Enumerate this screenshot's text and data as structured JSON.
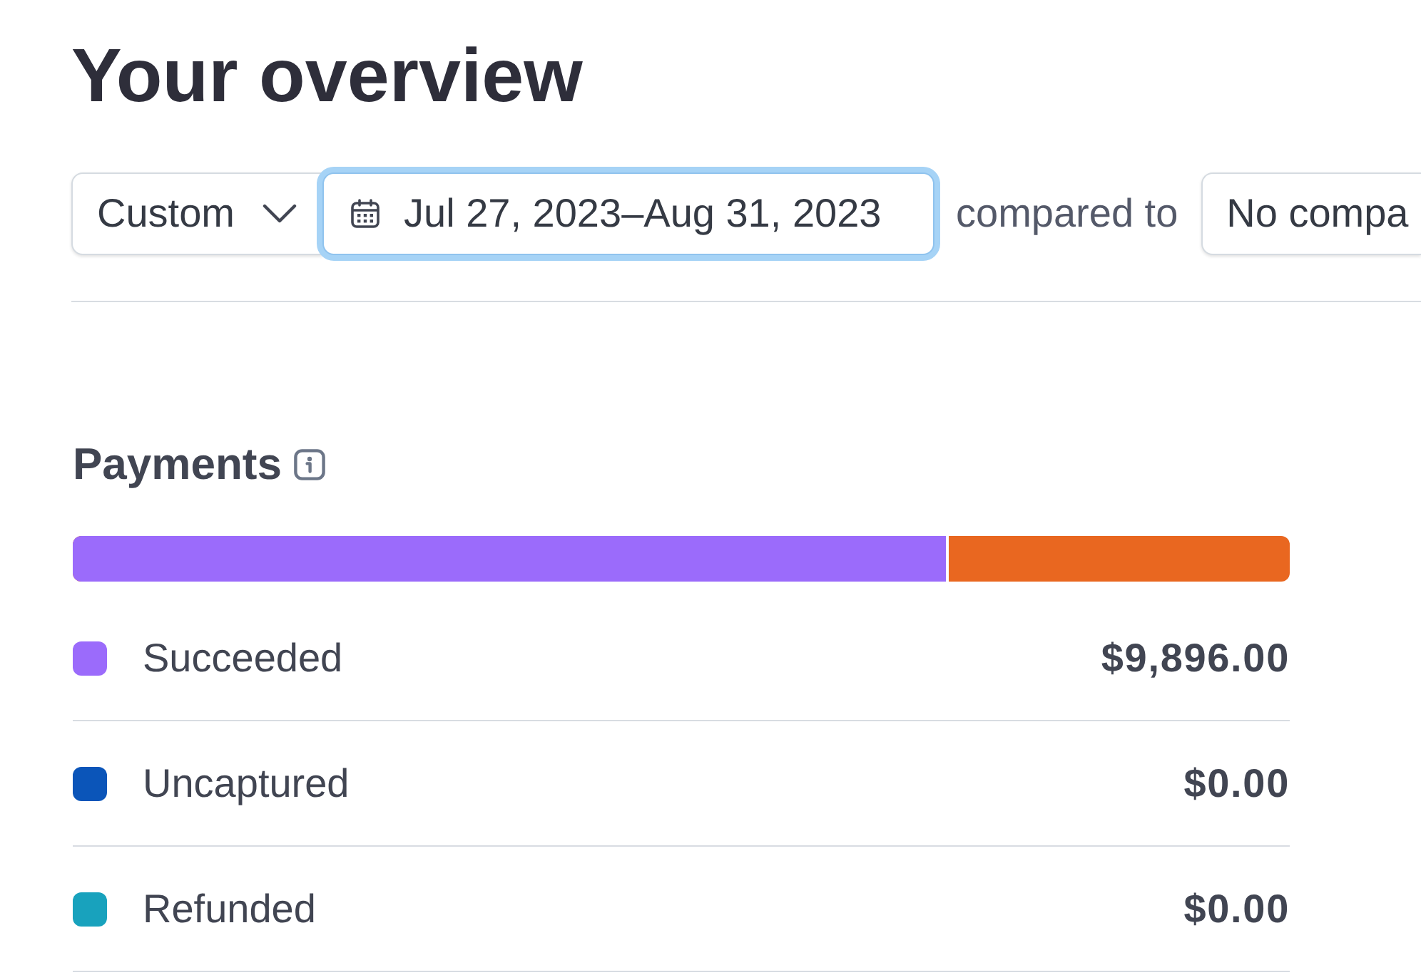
{
  "title": "Your overview",
  "filters": {
    "period": {
      "label": "Custom"
    },
    "date_range": {
      "label": "Jul 27, 2023–Aug 31, 2023",
      "focused": true
    },
    "compare_label": "compared to",
    "comparison": {
      "label": "No compa"
    }
  },
  "payments": {
    "title": "Payments",
    "bar": {
      "level": 0.72
    },
    "rows": [
      {
        "label": "Succeeded",
        "amount": "$9,896.00",
        "color": "#9b6bfb"
      },
      {
        "label": "Uncaptured",
        "amount": "$0.00",
        "color": "#0b55b9"
      },
      {
        "label": "Refunded",
        "amount": "$0.00",
        "color": "#18a2bd"
      }
    ]
  }
}
